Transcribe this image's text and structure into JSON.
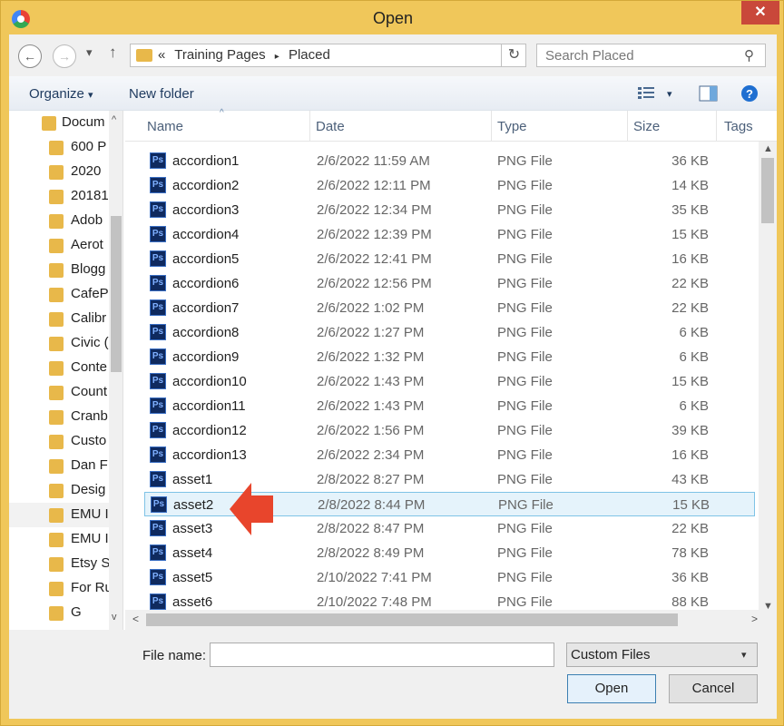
{
  "window": {
    "title": "Open",
    "close_symbol": "✕"
  },
  "nav": {
    "back": "←",
    "forward": "→",
    "recent_dd": "▾",
    "up": "↑",
    "address_prefix": "«",
    "breadcrumbs": [
      "Training Pages",
      "Placed"
    ],
    "crumb_sep": "▸",
    "refresh": "↻",
    "search_placeholder": "Search Placed",
    "search_icon": "⚲"
  },
  "toolbar": {
    "organize": "Organize",
    "organize_dd": "▾",
    "new_folder": "New folder",
    "help": "?"
  },
  "tree": {
    "items": [
      "Docum",
      "600 P",
      "2020",
      "20181",
      "Adob",
      "Aerot",
      "Blogg",
      "CafeP",
      "Calibr",
      "Civic (",
      "Conte",
      "Count",
      "Cranb",
      "Custo",
      "Dan F",
      "Desig",
      "EMU I",
      "EMU I",
      "Etsy S",
      "For Ru",
      "G"
    ],
    "selected_index": 16
  },
  "columns": {
    "name": "Name",
    "date": "Date",
    "type": "Type",
    "size": "Size",
    "tags": "Tags",
    "sort_indicator": "^"
  },
  "files": [
    {
      "name": "accordion1",
      "date": "2/6/2022 11:59 AM",
      "type": "PNG File",
      "size": "36 KB"
    },
    {
      "name": "accordion2",
      "date": "2/6/2022 12:11 PM",
      "type": "PNG File",
      "size": "14 KB"
    },
    {
      "name": "accordion3",
      "date": "2/6/2022 12:34 PM",
      "type": "PNG File",
      "size": "35 KB"
    },
    {
      "name": "accordion4",
      "date": "2/6/2022 12:39 PM",
      "type": "PNG File",
      "size": "15 KB"
    },
    {
      "name": "accordion5",
      "date": "2/6/2022 12:41 PM",
      "type": "PNG File",
      "size": "16 KB"
    },
    {
      "name": "accordion6",
      "date": "2/6/2022 12:56 PM",
      "type": "PNG File",
      "size": "22 KB"
    },
    {
      "name": "accordion7",
      "date": "2/6/2022 1:02 PM",
      "type": "PNG File",
      "size": "22 KB"
    },
    {
      "name": "accordion8",
      "date": "2/6/2022 1:27 PM",
      "type": "PNG File",
      "size": "6 KB"
    },
    {
      "name": "accordion9",
      "date": "2/6/2022 1:32 PM",
      "type": "PNG File",
      "size": "6 KB"
    },
    {
      "name": "accordion10",
      "date": "2/6/2022 1:43 PM",
      "type": "PNG File",
      "size": "15 KB"
    },
    {
      "name": "accordion11",
      "date": "2/6/2022 1:43 PM",
      "type": "PNG File",
      "size": "6 KB"
    },
    {
      "name": "accordion12",
      "date": "2/6/2022 1:56 PM",
      "type": "PNG File",
      "size": "39 KB"
    },
    {
      "name": "accordion13",
      "date": "2/6/2022 2:34 PM",
      "type": "PNG File",
      "size": "16 KB"
    },
    {
      "name": "asset1",
      "date": "2/8/2022 8:27 PM",
      "type": "PNG File",
      "size": "43 KB"
    },
    {
      "name": "asset2",
      "date": "2/8/2022 8:44 PM",
      "type": "PNG File",
      "size": "15 KB"
    },
    {
      "name": "asset3",
      "date": "2/8/2022 8:47 PM",
      "type": "PNG File",
      "size": "22 KB"
    },
    {
      "name": "asset4",
      "date": "2/8/2022 8:49 PM",
      "type": "PNG File",
      "size": "78 KB"
    },
    {
      "name": "asset5",
      "date": "2/10/2022 7:41 PM",
      "type": "PNG File",
      "size": "36 KB"
    },
    {
      "name": "asset6",
      "date": "2/10/2022 7:48 PM",
      "type": "PNG File",
      "size": "88 KB"
    }
  ],
  "selected_file_index": 14,
  "file_icon_text": "Ps",
  "bottom": {
    "file_name_label": "File name:",
    "file_name_value": "",
    "file_name_dd": "▾",
    "filter_value": "Custom Files",
    "filter_dd": "▾",
    "open_label": "Open",
    "cancel_label": "Cancel"
  },
  "scroll": {
    "up": "▲",
    "down": "▼",
    "left": "<",
    "right": ">",
    "tree_up": "^",
    "tree_down": "v"
  },
  "colors": {
    "window_frame": "#f0c75a",
    "close_button": "#c9483a",
    "selection": "#e5f3fb",
    "annotation_arrow": "#e8452c"
  }
}
